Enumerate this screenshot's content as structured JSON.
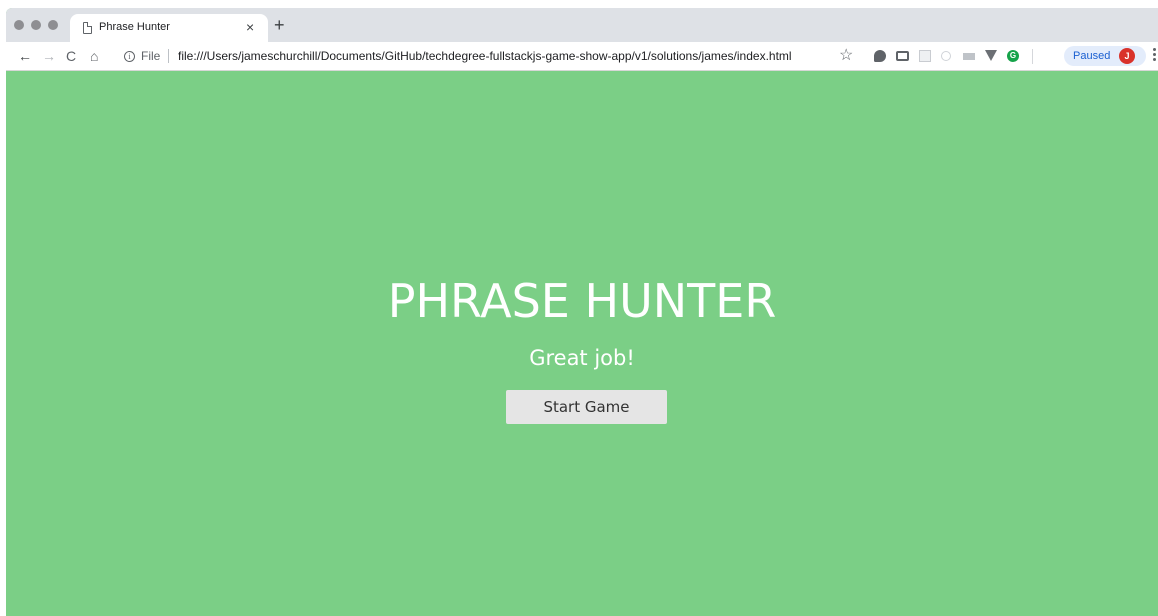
{
  "browser": {
    "tab": {
      "title": "Phrase Hunter",
      "close_glyph": "×",
      "icon": "document-icon"
    },
    "new_tab_glyph": "+",
    "nav": {
      "back_glyph": "←",
      "forward_glyph": "→",
      "reload_glyph": "C",
      "home_glyph": "⌂"
    },
    "address_bar": {
      "scheme_label": "File",
      "url": "file:///Users/jameschurchill/Documents/GitHub/techdegree-fullstackjs-game-show-app/v1/solutions/james/index.html"
    },
    "bookmark_glyph": "☆",
    "extensions": [
      "chat-bubble-icon",
      "inbox-icon",
      "square-icon",
      "circle-icon",
      "bar-icon",
      "triangle-v-icon",
      "grammarly-icon"
    ],
    "grammarly_letter": "G",
    "profile": {
      "paused_label": "Paused",
      "avatar_letter": "J"
    }
  },
  "page": {
    "background_color": "#7bcf86",
    "title": "PHRASE HUNTER",
    "message": "Great job!",
    "start_button_label": "Start Game"
  }
}
